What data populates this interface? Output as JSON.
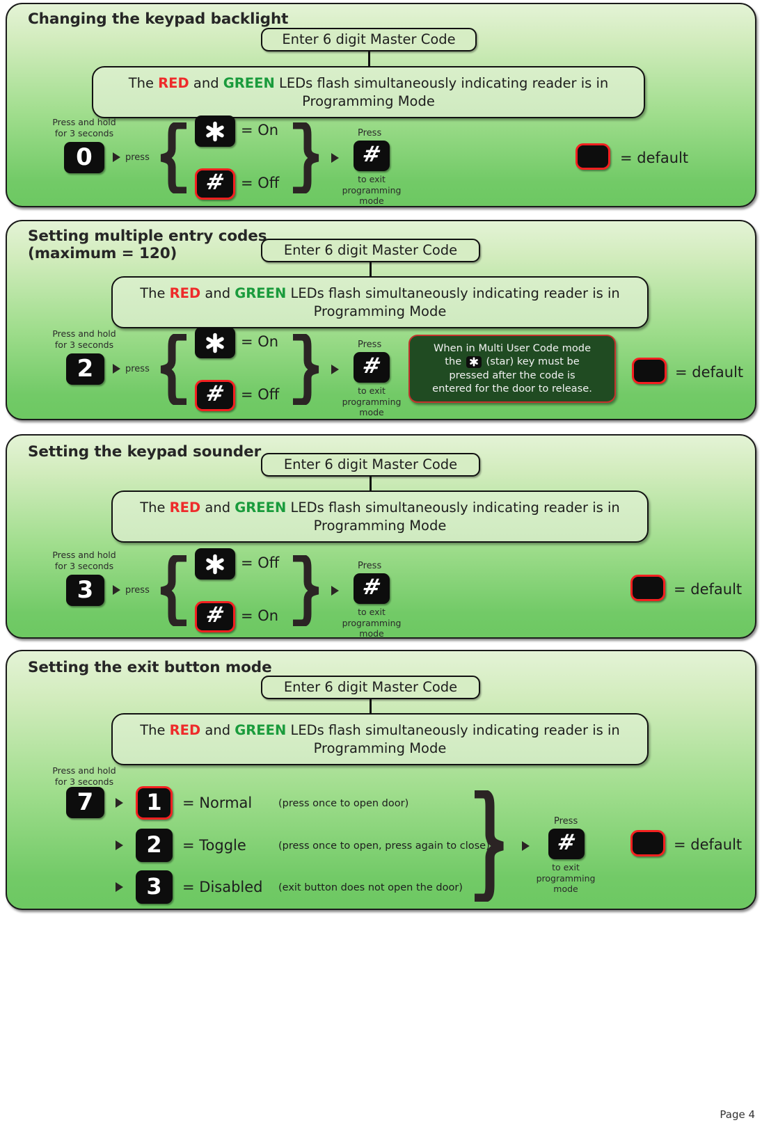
{
  "document": {
    "page_label": "Page 4",
    "colors": {
      "red": "#ee2b2b",
      "green": "#1a9b3c",
      "panel_top": "#e4f3d6",
      "panel_bottom": "#6dc862",
      "key_black": "#0d0d0d",
      "highlight_red": "#f42020",
      "note_bg": "#204b22"
    }
  },
  "common": {
    "master_code_label": "Enter 6 digit Master Code",
    "led_text": {
      "before_red": "The ",
      "red": "RED",
      "between": " and ",
      "green": "GREEN",
      "after": " LEDs flash simultaneously indicating reader is in Programming Mode"
    },
    "press_hold_label": "Press and hold\nfor 3 seconds",
    "press_label": "press",
    "press_word": "Press",
    "exit_label": "to exit\nprogramming\nmode",
    "default_label": "= default",
    "exit_key_glyph": "#",
    "star_glyph": "*"
  },
  "sections": [
    {
      "id": "keypad-backlight",
      "title": "Changing the keypad backlight",
      "entry_key": "0",
      "options": [
        {
          "key": "*",
          "key_type": "star",
          "label": "= On",
          "highlight": false
        },
        {
          "key": "#",
          "key_type": "hash",
          "label": "= Off",
          "highlight": true
        }
      ]
    },
    {
      "id": "multiple-entry-codes",
      "title": "Setting multiple entry codes\n(maximum = 120)",
      "entry_key": "2",
      "options": [
        {
          "key": "*",
          "key_type": "star",
          "label": "= On",
          "highlight": false
        },
        {
          "key": "#",
          "key_type": "hash",
          "label": "= Off",
          "highlight": true
        }
      ],
      "note": {
        "line1": "When in Multi User Code mode",
        "line2_a": "the",
        "line2_b": "(star) key must be",
        "line3": "pressed after the code is",
        "line4": "entered for the door to release."
      }
    },
    {
      "id": "keypad-sounder",
      "title": "Setting the keypad sounder",
      "entry_key": "3",
      "options": [
        {
          "key": "*",
          "key_type": "star",
          "label": "= Off",
          "highlight": false
        },
        {
          "key": "#",
          "key_type": "hash",
          "label": "= On",
          "highlight": true
        }
      ]
    },
    {
      "id": "exit-button-mode",
      "title": "Setting the exit button mode",
      "entry_key": "7",
      "options": [
        {
          "key": "1",
          "key_type": "digit",
          "label": "= Normal",
          "note": "(press once to open door)",
          "highlight": true
        },
        {
          "key": "2",
          "key_type": "digit",
          "label": "= Toggle",
          "note": "(press once to open, press again to close)",
          "highlight": false
        },
        {
          "key": "3",
          "key_type": "digit",
          "label": "= Disabled",
          "note": "(exit button does not open the door)",
          "highlight": false
        }
      ]
    }
  ]
}
